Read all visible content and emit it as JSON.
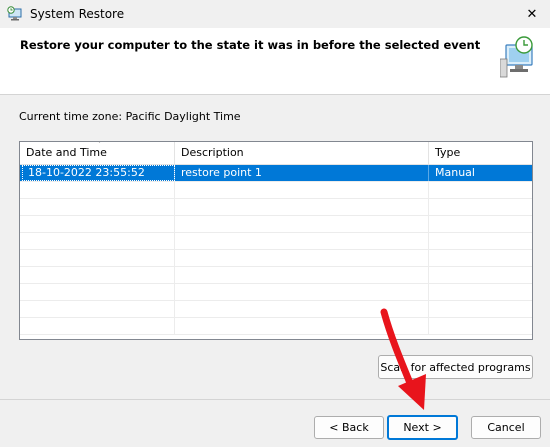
{
  "window": {
    "title": "System Restore",
    "close_glyph": "✕"
  },
  "header": {
    "headline": "Restore your computer to the state it was in before the selected event"
  },
  "timezone": "Current time zone: Pacific Daylight Time",
  "list": {
    "columns": [
      "Date and Time",
      "Description",
      "Type"
    ],
    "rows": [
      {
        "date": "18-10-2022 23:55:52",
        "description": "restore point 1",
        "type": "Manual",
        "selected": true
      }
    ]
  },
  "buttons": {
    "scan": "Scan for affected programs",
    "back": "< Back",
    "next": "Next >",
    "cancel": "Cancel"
  },
  "colors": {
    "selection": "#0078d7",
    "annotation_arrow": "#e8141c"
  },
  "icons": [
    "system-restore-icon",
    "close-icon",
    "sort-chevron-icon",
    "restore-computer-graphic-icon"
  ]
}
